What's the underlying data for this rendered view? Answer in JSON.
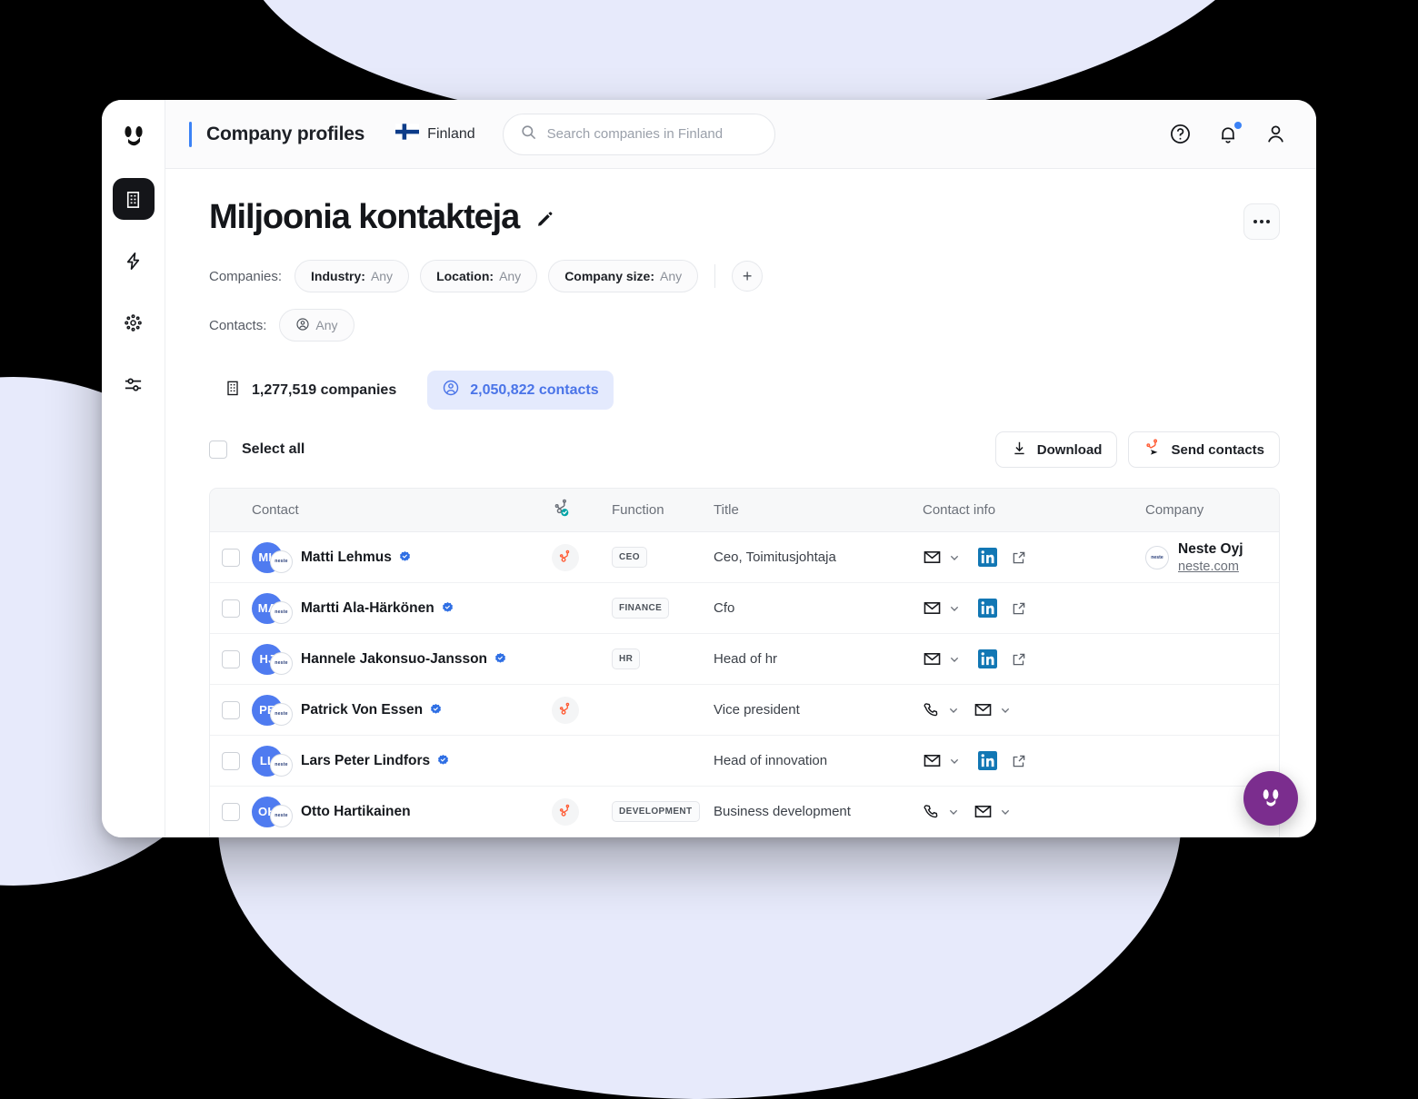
{
  "topbar": {
    "app_title": "Company profiles",
    "country": "Finland",
    "search_placeholder": "Search companies in Finland",
    "search_value": "",
    "icons": [
      "help-icon",
      "notifications-bell-icon",
      "account-icon"
    ]
  },
  "sidebar": {
    "items": [
      {
        "name": "company-profiles",
        "icon": "building-icon",
        "active": true
      },
      {
        "name": "signals",
        "icon": "lightning-bolt-icon",
        "active": false
      },
      {
        "name": "network",
        "icon": "nodes-icon",
        "active": false
      },
      {
        "name": "settings",
        "icon": "sliders-icon",
        "active": false
      }
    ]
  },
  "page": {
    "title": "Miljoonia kontakteja",
    "more_label": "…"
  },
  "filters": {
    "companies_label": "Companies:",
    "contacts_label": "Contacts:",
    "company_chips": [
      {
        "key": "Industry:",
        "value": "Any"
      },
      {
        "key": "Location:",
        "value": "Any"
      },
      {
        "key": "Company size:",
        "value": "Any"
      }
    ],
    "add_label": "+",
    "contact_chip": {
      "value": "Any"
    }
  },
  "counts": {
    "companies": "1,277,519 companies",
    "contacts": "2,050,822 contacts",
    "accent": "#4a74e8",
    "accent_bg": "#e4eafd"
  },
  "toolbar": {
    "select_all_label": "Select all",
    "download_label": "Download",
    "send_contacts_label": "Send contacts"
  },
  "table": {
    "headers": {
      "contact": "Contact",
      "hubspot": "",
      "function": "Function",
      "title": "Title",
      "contact_info": "Contact info",
      "company": "Company"
    },
    "rows": [
      {
        "initials": "ML",
        "badge": "neste",
        "name": "Matti Lehmus",
        "verified": true,
        "hubspot": true,
        "function": "CEO",
        "title": "Ceo, Toimitusjohtaja",
        "has_phone": false,
        "has_email": true,
        "has_linkedin": true,
        "company_name": "Neste Oyj",
        "company_url": "neste.com",
        "company_logo": "neste"
      },
      {
        "initials": "MA",
        "badge": "neste",
        "name": "Martti Ala-Härkönen",
        "verified": true,
        "hubspot": false,
        "function": "FINANCE",
        "title": "Cfo",
        "has_phone": false,
        "has_email": true,
        "has_linkedin": true,
        "company_name": "",
        "company_url": "",
        "company_logo": ""
      },
      {
        "initials": "HJ",
        "badge": "neste",
        "name": "Hannele Jakonsuo-Jansson",
        "verified": true,
        "hubspot": false,
        "function": "HR",
        "title": "Head of hr",
        "has_phone": false,
        "has_email": true,
        "has_linkedin": true,
        "company_name": "",
        "company_url": "",
        "company_logo": ""
      },
      {
        "initials": "PE",
        "badge": "neste",
        "name": "Patrick Von Essen",
        "verified": true,
        "hubspot": true,
        "function": "",
        "title": "Vice president",
        "has_phone": true,
        "has_email": true,
        "has_linkedin": false,
        "company_name": "",
        "company_url": "",
        "company_logo": ""
      },
      {
        "initials": "LL",
        "badge": "neste",
        "name": "Lars Peter Lindfors",
        "verified": true,
        "hubspot": false,
        "function": "",
        "title": "Head of innovation",
        "has_phone": false,
        "has_email": true,
        "has_linkedin": true,
        "company_name": "",
        "company_url": "",
        "company_logo": ""
      },
      {
        "initials": "OH",
        "badge": "neste",
        "name": "Otto Hartikainen",
        "verified": false,
        "hubspot": true,
        "function": "DEVELOPMENT",
        "title": "Business development",
        "has_phone": true,
        "has_email": true,
        "has_linkedin": false,
        "company_name": "",
        "company_url": "",
        "company_logo": ""
      }
    ]
  },
  "chat": {
    "label": "chat-widget"
  }
}
